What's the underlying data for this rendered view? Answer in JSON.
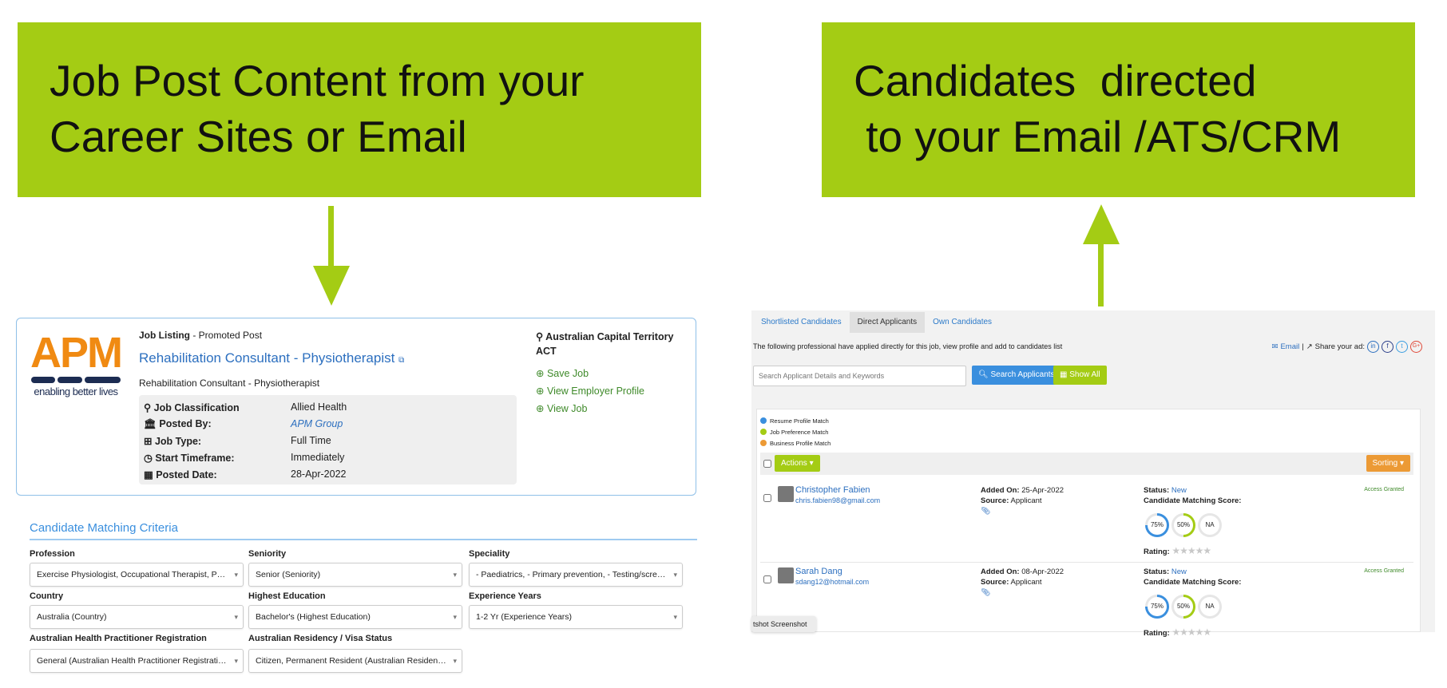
{
  "banners": {
    "left": {
      "line1": "Job Post Content from your",
      "line2": "Career Sites or Email"
    },
    "right": {
      "line1": "Candidates  directed",
      "line2": " to your Email /ATS/CRM"
    },
    "color": "#a4cc14"
  },
  "job": {
    "logo": {
      "text": "APM",
      "tagline": "enabling better lives",
      "color": "#f08a12"
    },
    "listing_label": "Job Listing",
    "listing_type": " - Promoted Post",
    "title": "Rehabilitation Consultant - Physiotherapist",
    "subtitle": "Rehabilitation Consultant - Physiotherapist",
    "details": [
      {
        "icon": "sitemap-icon",
        "label": "Job Classification",
        "value": "Allied Health"
      },
      {
        "icon": "bank-icon",
        "label": "Posted By:",
        "value": "APM Group"
      },
      {
        "icon": "hierarchy-icon",
        "label": "Job Type:",
        "value": "Full Time"
      },
      {
        "icon": "clock-icon",
        "label": "Start Timeframe:",
        "value": "Immediately"
      },
      {
        "icon": "calendar-icon",
        "label": "Posted Date:",
        "value": "28-Apr-2022"
      }
    ],
    "location_line1": "Australian Capital Territory",
    "location_line2": "ACT",
    "actions": [
      "Save Job",
      "View Employer Profile",
      "View Job"
    ]
  },
  "criteria": {
    "title": "Candidate Matching Criteria",
    "fields": [
      {
        "label": "Profession",
        "value": "Exercise Physiologist, Occupational Therapist, Physiotherapist"
      },
      {
        "label": "Seniority",
        "value": "Senior (Seniority)"
      },
      {
        "label": "Speciality",
        "value": "- Paediatrics, - Primary prevention, - Testing/screening (Speciality)"
      },
      {
        "label": "Country",
        "value": "Australia (Country)"
      },
      {
        "label": "Highest Education",
        "value": "Bachelor's (Highest Education)"
      },
      {
        "label": "Experience Years",
        "value": "1-2 Yr (Experience Years)"
      },
      {
        "label": "Australian Health Practitioner Registration",
        "value": "General (Australian Health Practitioner Registration)"
      },
      {
        "label": "Australian Residency / Visa Status",
        "value": "Citizen, Permanent Resident (Australian Residency / Visa Status)"
      }
    ]
  },
  "applicants": {
    "tabs": [
      "Shortlisted Candidates",
      "Direct Applicants",
      "Own Candidates"
    ],
    "active_tab": "Direct Applicants",
    "description": "The following professional have applied directly for this job, view profile and add to candidates list",
    "email_label": "Email",
    "share_label": "Share your ad:",
    "search_placeholder": "Search Applicant Details and Keywords",
    "search_button": "Search Applicants",
    "show_all_button": "Show All",
    "legend": [
      {
        "label": "Resume Profile Match",
        "color": "#3a8fde"
      },
      {
        "label": "Job Preference Match",
        "color": "#a4cc14"
      },
      {
        "label": "Business Profile Match",
        "color": "#ec9a35"
      }
    ],
    "actions_button": "Actions",
    "sorting_button": "Sorting",
    "added_label": "Added On:",
    "source_label": "Source:",
    "status_label": "Status:",
    "score_label": "Candidate Matching Score:",
    "rating_label": "Rating:",
    "candidates": [
      {
        "name": "Christopher Fabien",
        "email": "chris.fabien98@gmail.com",
        "added": " 25-Apr-2022",
        "source": " Applicant",
        "status": " New",
        "access": "Access Granted",
        "scores": [
          "75%",
          "50%",
          "NA"
        ],
        "rating": 0
      },
      {
        "name": "Sarah Dang",
        "email": "sdang12@hotmail.com",
        "added": " 08-Apr-2022",
        "source": " Applicant",
        "status": " New",
        "access": "Access Granted",
        "scores": [
          "75%",
          "50%",
          "NA"
        ],
        "rating": 0
      }
    ],
    "tooltip": "tshot Screenshot"
  }
}
